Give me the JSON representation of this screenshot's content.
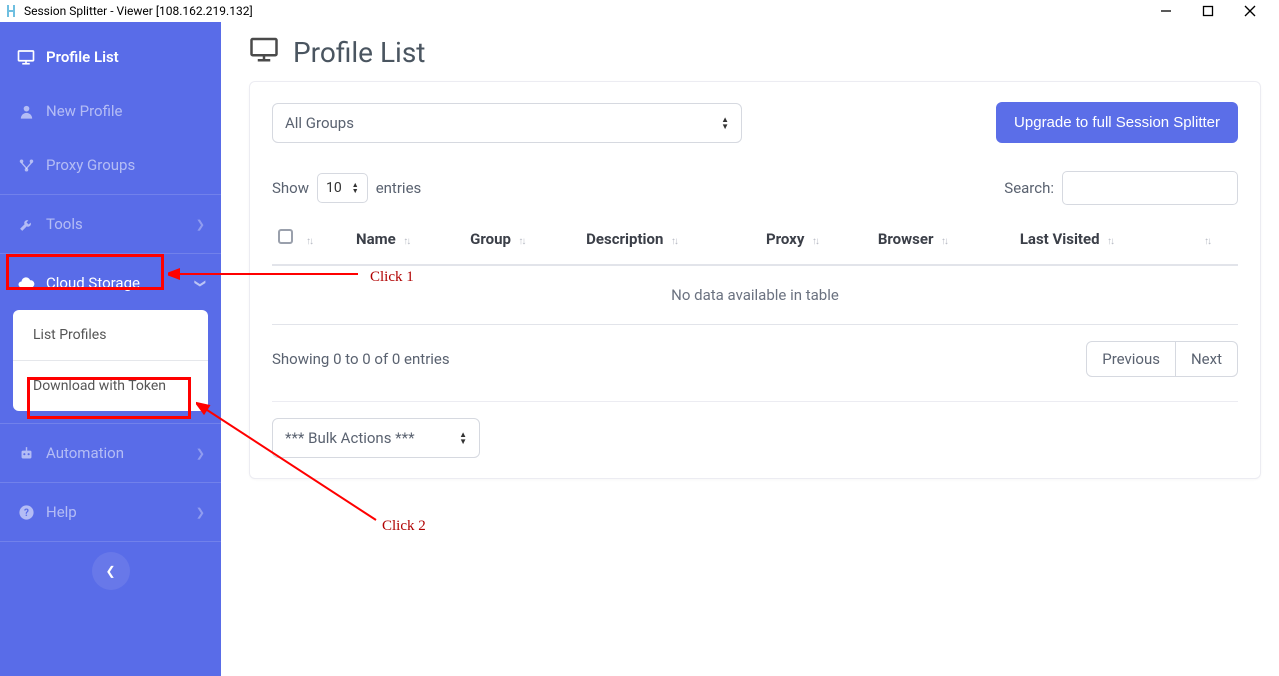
{
  "window": {
    "title": "Session Splitter - Viewer [108.162.219.132]"
  },
  "sidebar": {
    "profile_list": "Profile List",
    "new_profile": "New Profile",
    "proxy_groups": "Proxy Groups",
    "tools": "Tools",
    "cloud_storage": "Cloud Storage",
    "cloud_sub": {
      "list_profiles": "List Profiles",
      "download_token": "Download with Token"
    },
    "automation": "Automation",
    "help": "Help"
  },
  "page": {
    "title": "Profile List"
  },
  "controls": {
    "group_select": "All Groups",
    "upgrade_btn": "Upgrade to full Session Splitter",
    "show_label": "Show",
    "entries_label": "entries",
    "show_value": "10",
    "search_label": "Search:",
    "bulk_select": "*** Bulk Actions ***"
  },
  "table": {
    "headers": {
      "name": "Name",
      "group": "Group",
      "description": "Description",
      "proxy": "Proxy",
      "browser": "Browser",
      "last_visited": "Last Visited"
    },
    "no_data": "No data available in table",
    "showing": "Showing 0 to 0 of 0 entries",
    "prev": "Previous",
    "next": "Next"
  },
  "annotations": {
    "click1": "Click 1",
    "click2": "Click 2"
  }
}
